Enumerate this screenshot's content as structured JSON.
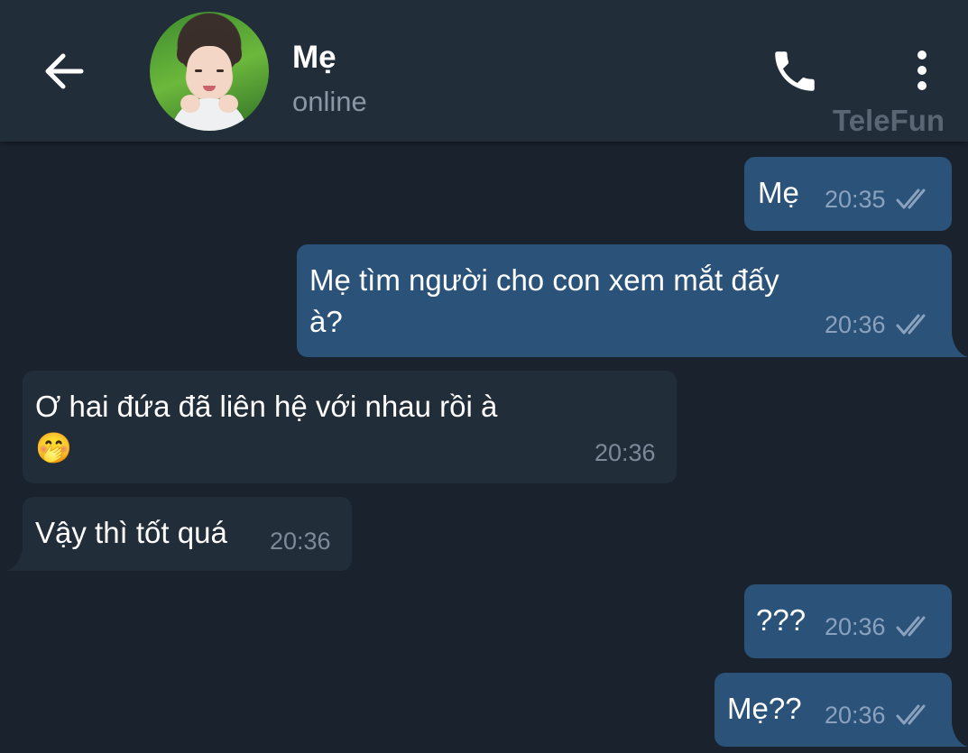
{
  "header": {
    "contact_name": "Mẹ",
    "status": "online",
    "watermark": "TeleFun",
    "back_icon": "arrow-left-icon",
    "call_icon": "phone-icon",
    "menu_icon": "more-vertical-icon"
  },
  "messages": [
    {
      "direction": "out",
      "text": "Mẹ",
      "time": "20:35",
      "read": true
    },
    {
      "direction": "out",
      "text_line1": "Mẹ tìm người cho con xem mắt đấy",
      "text_line2": "à?",
      "time": "20:36",
      "read": true
    },
    {
      "direction": "in",
      "text_line1": "Ơ hai đứa đã liên hệ với nhau rồi à",
      "emoji": "🤭",
      "time": "20:36"
    },
    {
      "direction": "in",
      "text": "Vậy thì tốt quá",
      "time": "20:36"
    },
    {
      "direction": "out",
      "text": "???",
      "time": "20:36",
      "read": true
    },
    {
      "direction": "out",
      "text": "Mẹ??",
      "time": "20:36",
      "read": true
    }
  ],
  "colors": {
    "background": "#19222d",
    "header": "#222d3a",
    "outgoing_bubble": "#2b5278",
    "incoming_bubble": "#222d3a",
    "read_check": "#8aa2bd"
  }
}
